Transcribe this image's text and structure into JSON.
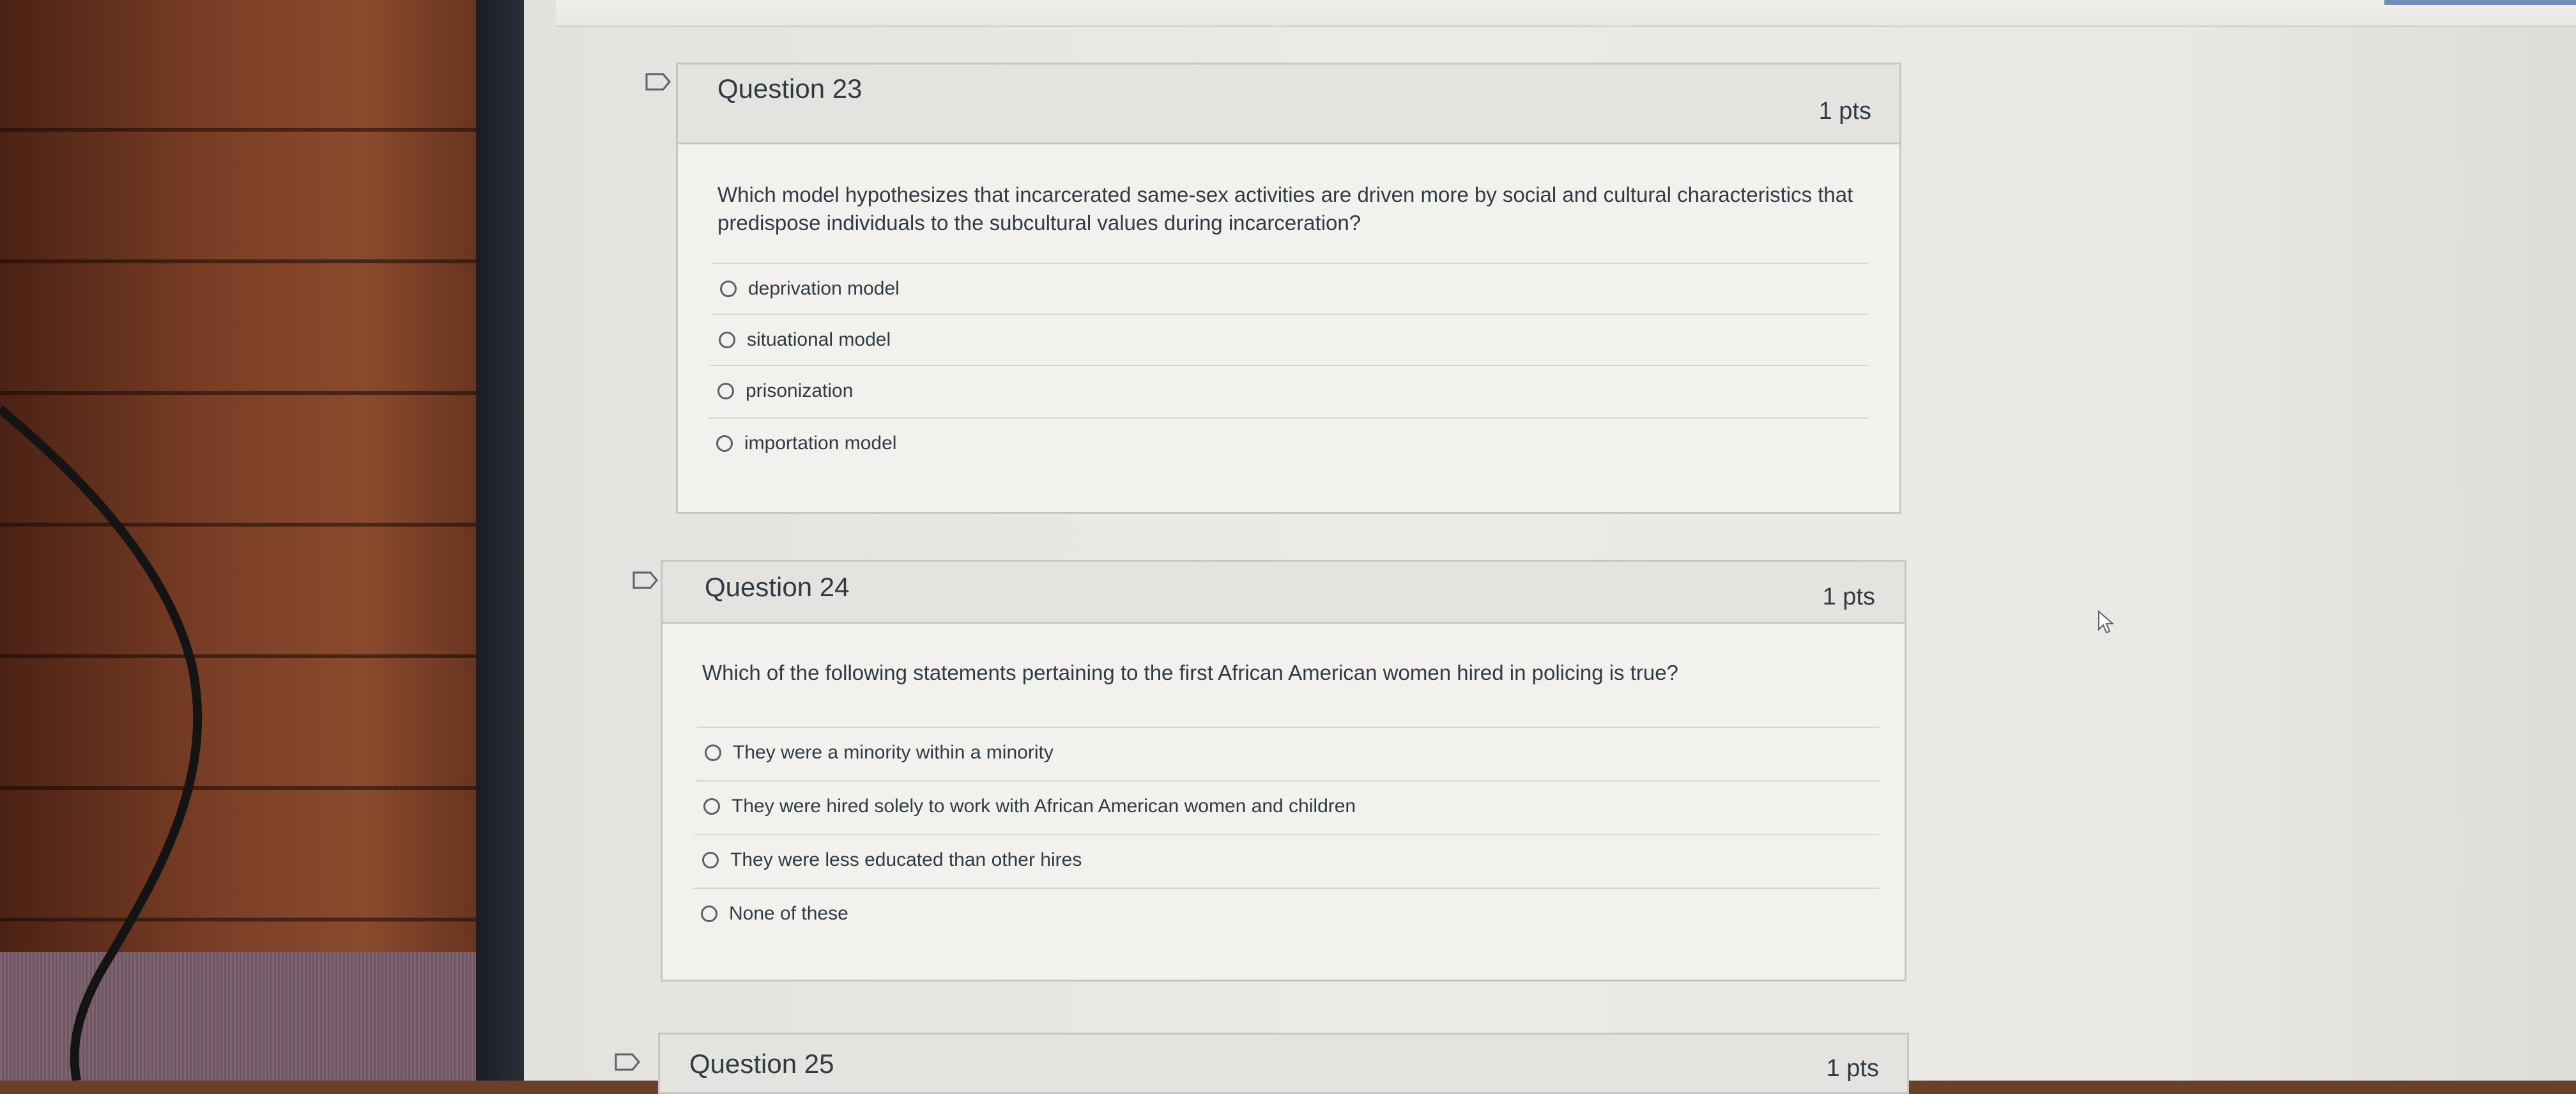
{
  "quiz": {
    "questions": [
      {
        "title": "Question 23",
        "points": "1 pts",
        "text": "Which model hypothesizes that incarcerated same-sex activities are driven more by social and cultural characteristics that predispose individuals to the subcultural values during incarceration?",
        "answers": [
          "deprivation model",
          "situational model",
          "prisonization",
          "importation model"
        ]
      },
      {
        "title": "Question 24",
        "points": "1 pts",
        "text": "Which of the following statements pertaining to the first African American women hired in policing is true?",
        "answers": [
          "They were a minority within a minority",
          "They were hired solely to work with African American women and children",
          "They were less educated than other hires",
          "None of these"
        ]
      },
      {
        "title": "Question 25",
        "points": "1 pts"
      }
    ]
  },
  "colors": {
    "text": "#2d3b45",
    "header_bg": "#e4e3df",
    "border": "#c6c6c2"
  }
}
